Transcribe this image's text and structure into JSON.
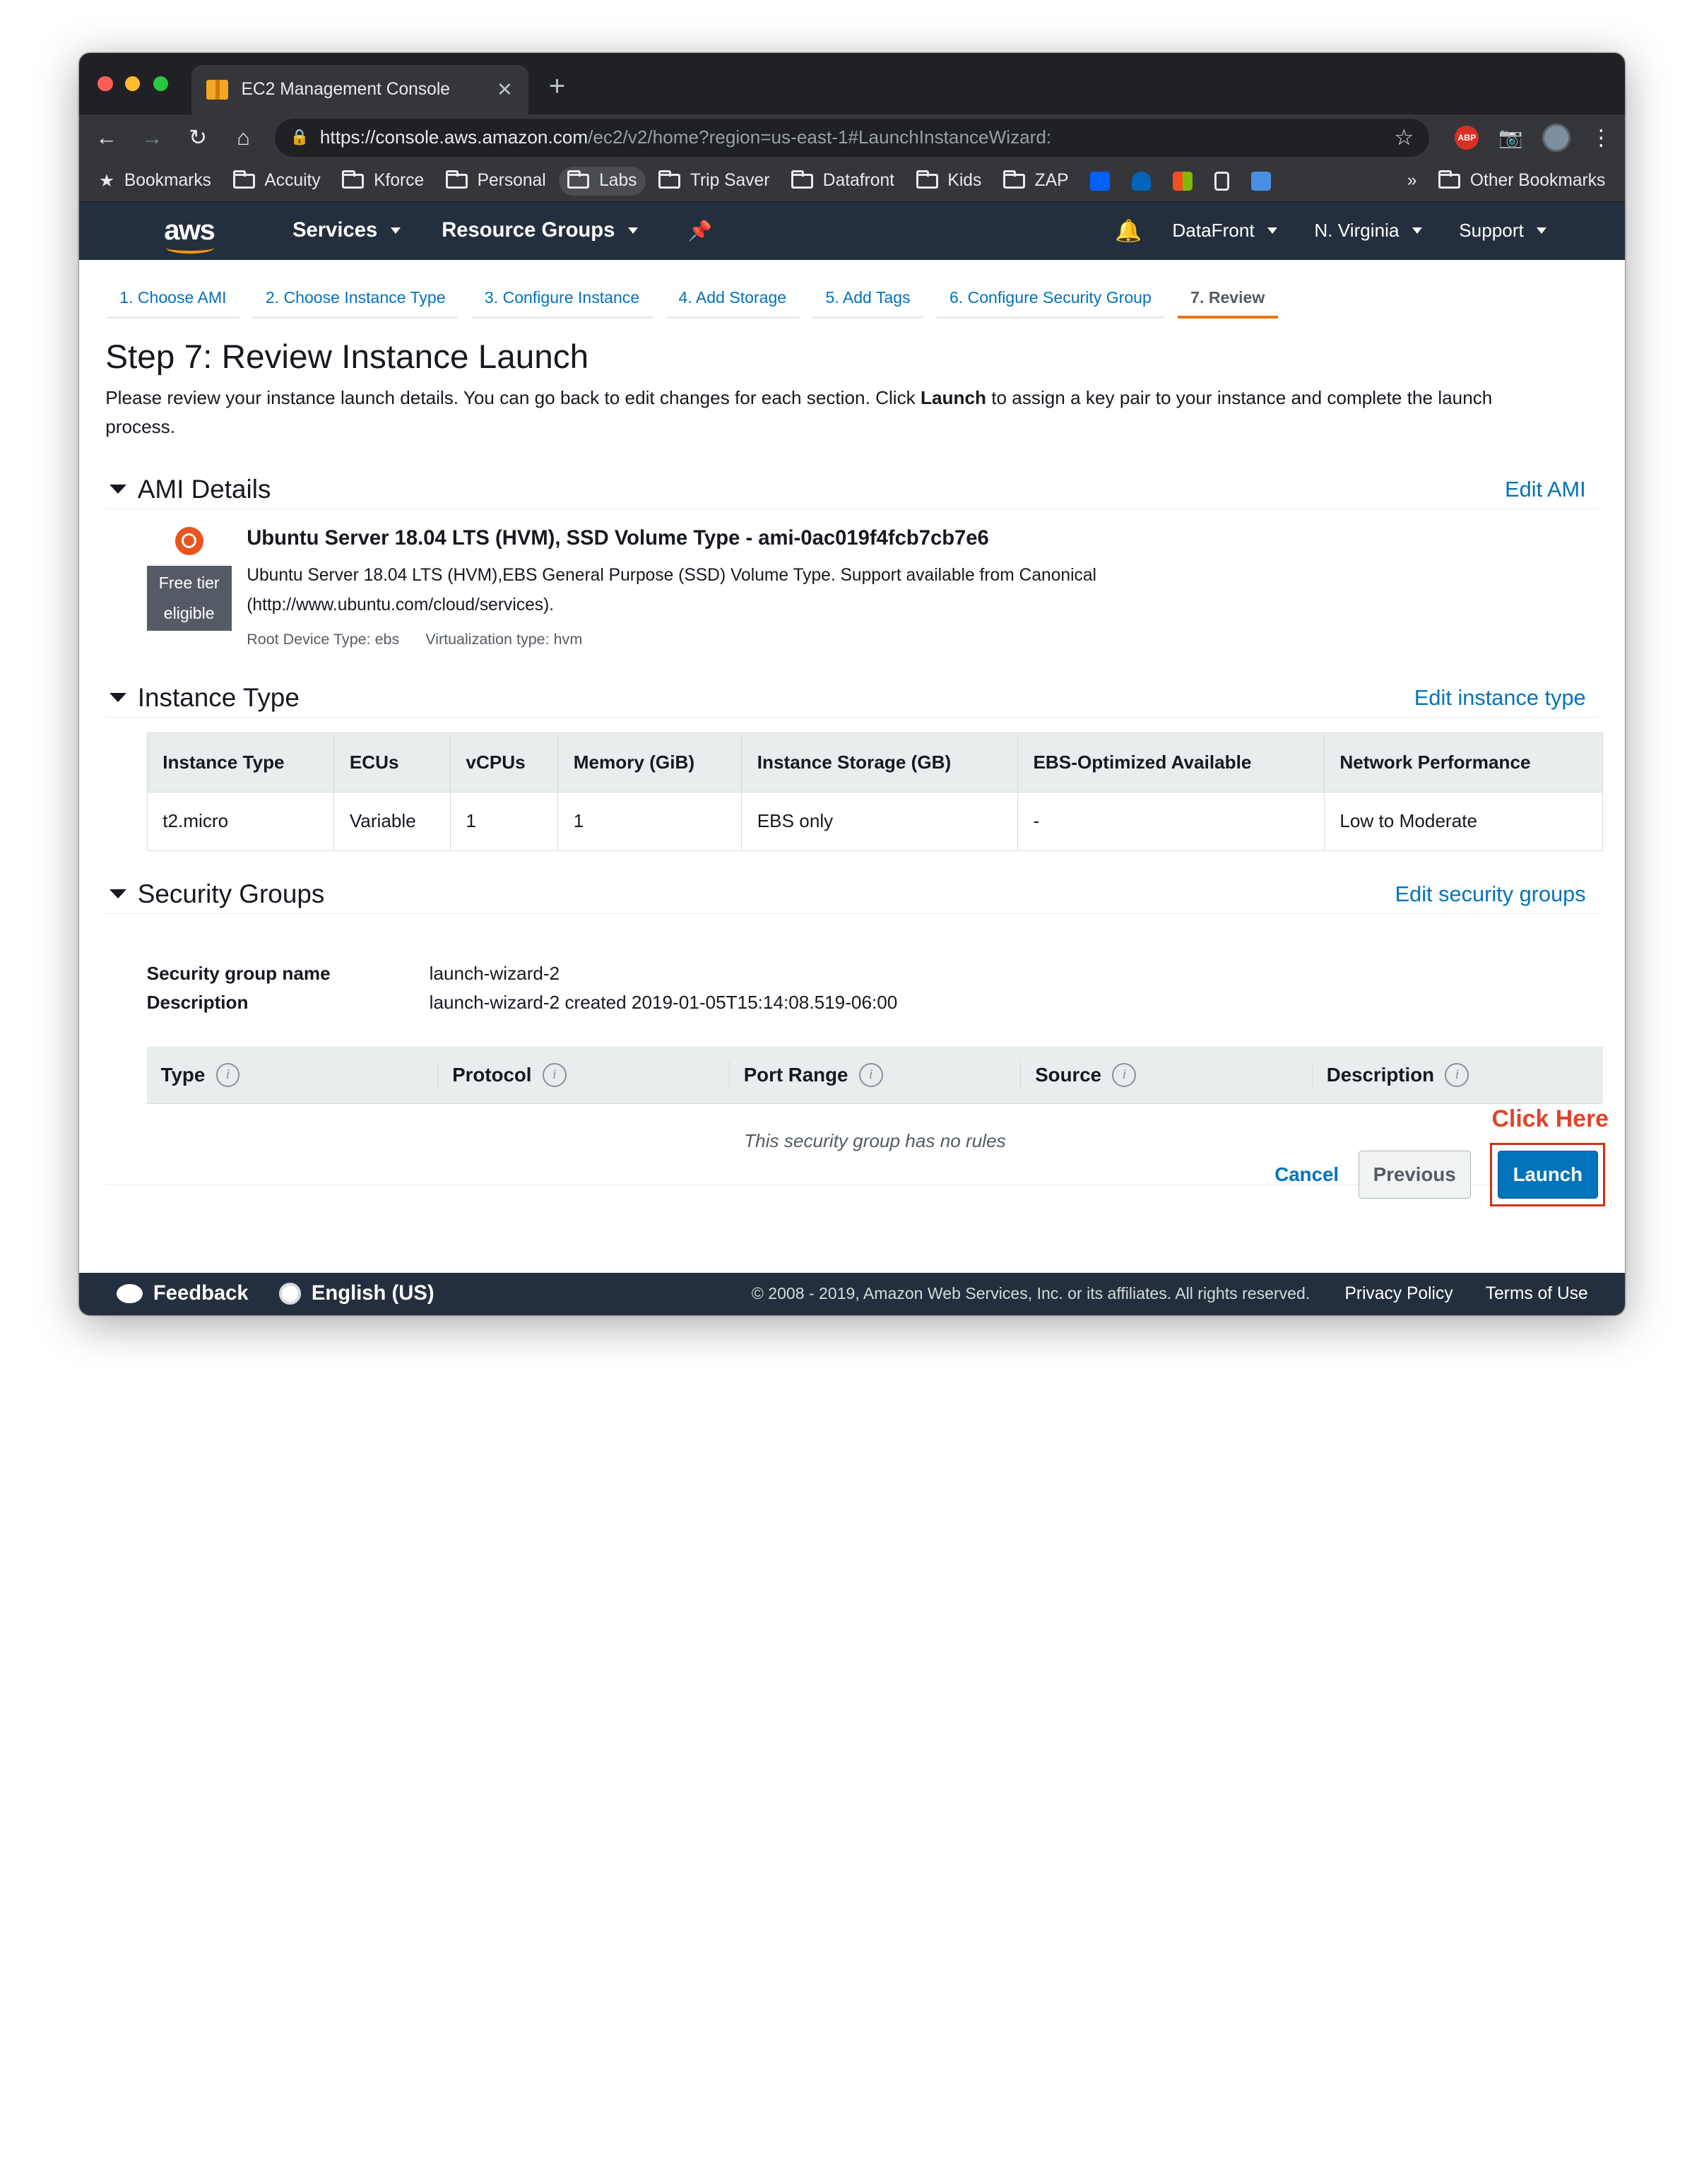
{
  "browser": {
    "tab_title": "EC2 Management Console",
    "url_domain": "https://console.aws.amazon.com",
    "url_path": "/ec2/v2/home?region=us-east-1#LaunchInstanceWizard:",
    "bookmarks": [
      "Bookmarks",
      "Accuity",
      "Kforce",
      "Personal",
      "Labs",
      "Trip Saver",
      "Datafront",
      "Kids",
      "ZAP"
    ],
    "more_bookmarks": "»",
    "other_bookmarks": "Other Bookmarks",
    "abp_label": "ABP"
  },
  "aws_nav": {
    "logo": "aws",
    "services": "Services",
    "resource_groups": "Resource Groups",
    "account": "DataFront",
    "region": "N. Virginia",
    "support": "Support"
  },
  "steps": [
    "1. Choose AMI",
    "2. Choose Instance Type",
    "3. Configure Instance",
    "4. Add Storage",
    "5. Add Tags",
    "6. Configure Security Group",
    "7. Review"
  ],
  "page": {
    "title": "Step 7: Review Instance Launch",
    "intro_before": "Please review your instance launch details. You can go back to edit changes for each section. Click ",
    "intro_bold": "Launch",
    "intro_after": " to assign a key pair to your instance and complete the launch process."
  },
  "ami": {
    "heading": "AMI Details",
    "edit": "Edit AMI",
    "name": "Ubuntu Server 18.04 LTS (HVM), SSD Volume Type - ami-0ac019f4fcb7cb7e6",
    "badge": "Free tier eligible",
    "description": "Ubuntu Server 18.04 LTS (HVM),EBS General Purpose (SSD) Volume Type. Support available from Canonical (http://www.ubuntu.com/cloud/services).",
    "root_device": "Root Device Type: ebs",
    "virtualization": "Virtualization type: hvm"
  },
  "instance_type": {
    "heading": "Instance Type",
    "edit": "Edit instance type",
    "columns": [
      "Instance Type",
      "ECUs",
      "vCPUs",
      "Memory (GiB)",
      "Instance Storage (GB)",
      "EBS-Optimized Available",
      "Network Performance"
    ],
    "row": [
      "t2.micro",
      "Variable",
      "1",
      "1",
      "EBS only",
      "-",
      "Low to Moderate"
    ]
  },
  "security_groups": {
    "heading": "Security Groups",
    "edit": "Edit security groups",
    "name_label": "Security group name",
    "name_value": "launch-wizard-2",
    "desc_label": "Description",
    "desc_value": "launch-wizard-2 created 2019-01-05T15:14:08.519-06:00",
    "rule_columns": [
      "Type",
      "Protocol",
      "Port Range",
      "Source",
      "Description"
    ],
    "empty_message": "This security group has no rules"
  },
  "actions": {
    "cancel": "Cancel",
    "previous": "Previous",
    "launch": "Launch",
    "annotation": "Click Here"
  },
  "footer": {
    "feedback": "Feedback",
    "language": "English (US)",
    "copyright": "© 2008 - 2019, Amazon Web Services, Inc. or its affiliates. All rights reserved.",
    "privacy": "Privacy Policy",
    "terms": "Terms of Use"
  },
  "colors": {
    "aws_nav_bg": "#232f3e",
    "link_blue": "#0073bb",
    "active_step": "#ec7211",
    "annotation_red": "#d13212"
  }
}
